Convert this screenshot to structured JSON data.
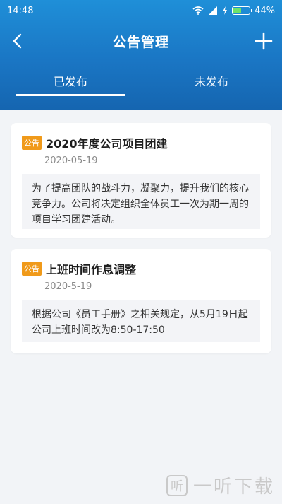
{
  "status": {
    "time": "14:48",
    "battery": "44%",
    "battery_level": 0.44
  },
  "nav": {
    "title": "公告管理"
  },
  "tabs": [
    {
      "label": "已发布",
      "active": true
    },
    {
      "label": "未发布",
      "active": false
    }
  ],
  "notices": [
    {
      "badge": "公告",
      "title": "2020年度公司项目团建",
      "date": "2020-05-19",
      "content": "为了提高团队的战斗力，凝聚力，提升我们的核心竞争力。公司将决定组织全体员工一次为期一周的项目学习团建活动。"
    },
    {
      "badge": "公告",
      "title": "上班时间作息调整",
      "date": "2020-5-19",
      "content": "根据公司《员工手册》之相关规定，从5月19日起公司上班时间改为8:50-17:50"
    }
  ],
  "watermark": {
    "logo": "听",
    "text": "一听下载"
  },
  "colors": {
    "header": "#1a76c4",
    "badge": "#f09a1a",
    "background": "#f2f4f7"
  }
}
